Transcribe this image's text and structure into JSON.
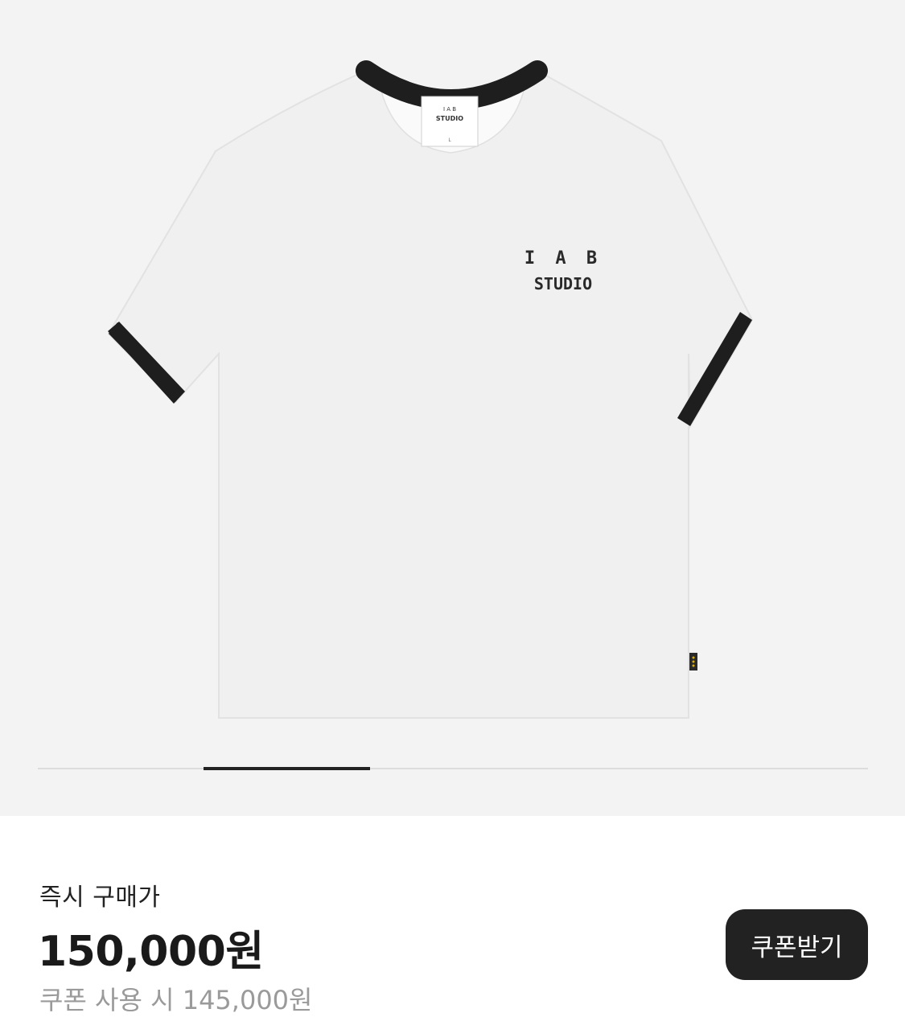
{
  "product": {
    "image_alt": "product-image-white-ringer-tshirt",
    "print_line1": "I A B",
    "print_line2": "STUDIO",
    "tag_line1": "I A B",
    "tag_line2": "STUDIO",
    "tag_size": "L",
    "image_count": 5,
    "current_image": 2
  },
  "purchase": {
    "label": "즉시 구매가",
    "price": "150,000원",
    "coupon_price": "쿠폰 사용 시 145,000원",
    "coupon_button": "쿠폰받기"
  },
  "colors": {
    "background": "#f3f3f3",
    "button": "#222222",
    "muted_text": "#9a9a9a"
  }
}
